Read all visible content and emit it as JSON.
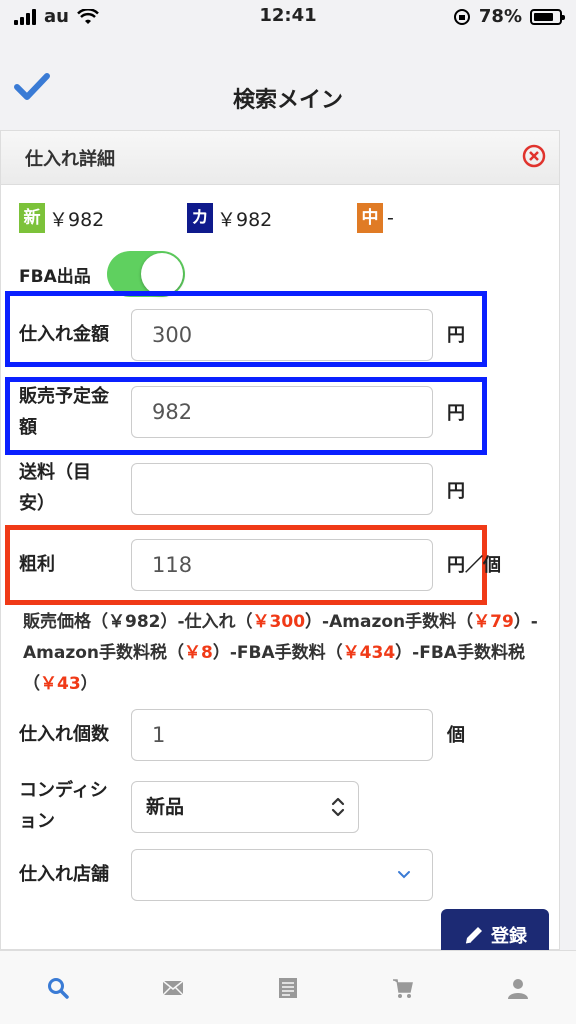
{
  "status_bar": {
    "carrier": "au",
    "time": "12:41",
    "battery": "78%",
    "battery_level": 0.78
  },
  "nav": {
    "title": "検索メイン"
  },
  "panel": {
    "title": "仕入れ詳細",
    "prices": [
      {
        "badge": "新",
        "color": "#7cc23a",
        "value": "￥982"
      },
      {
        "badge": "カ",
        "color": "#0f1a8c",
        "value": "￥982"
      },
      {
        "badge": "中",
        "color": "#e07b25",
        "value": "-"
      }
    ],
    "fba": {
      "label": "FBA出品",
      "enabled": true
    },
    "fields": {
      "cost": {
        "label": "仕入れ金額",
        "value": "300",
        "unit": "円"
      },
      "sale": {
        "label_1": "販売予定金",
        "label_2": "額",
        "value": "982",
        "unit": "円"
      },
      "shipping": {
        "label_1": "送料（目",
        "label_2": "安）",
        "value": "",
        "unit": "円"
      },
      "profit": {
        "label": "粗利",
        "value": "118",
        "unit": "円／個"
      },
      "quantity": {
        "label": "仕入れ個数",
        "value": "1",
        "unit": "個"
      },
      "condition": {
        "label_1": "コンディシ",
        "label_2": "ョン",
        "value": "新品"
      },
      "store": {
        "label": "仕入れ店舗",
        "value": ""
      }
    },
    "formula": {
      "p1": "販売価格（￥982）-仕入れ（",
      "v1": "￥300",
      "p2": "）-Amazon手数料（",
      "v2": "￥79",
      "p3": "）-Amazon手数料税（",
      "v3": "￥8",
      "p4": "）-FBA手数料（",
      "v4": "￥434",
      "p5": "）-FBA手数料税（",
      "v5": "￥43",
      "p6": "）"
    },
    "register_label": "登録"
  },
  "colors": {
    "highlight_blue": "#0a20ff",
    "highlight_red": "#f03a17",
    "accent": "#3a7bd5"
  },
  "tabs": [
    "search-icon",
    "mail-icon",
    "list-icon",
    "cart-icon",
    "user-icon"
  ]
}
